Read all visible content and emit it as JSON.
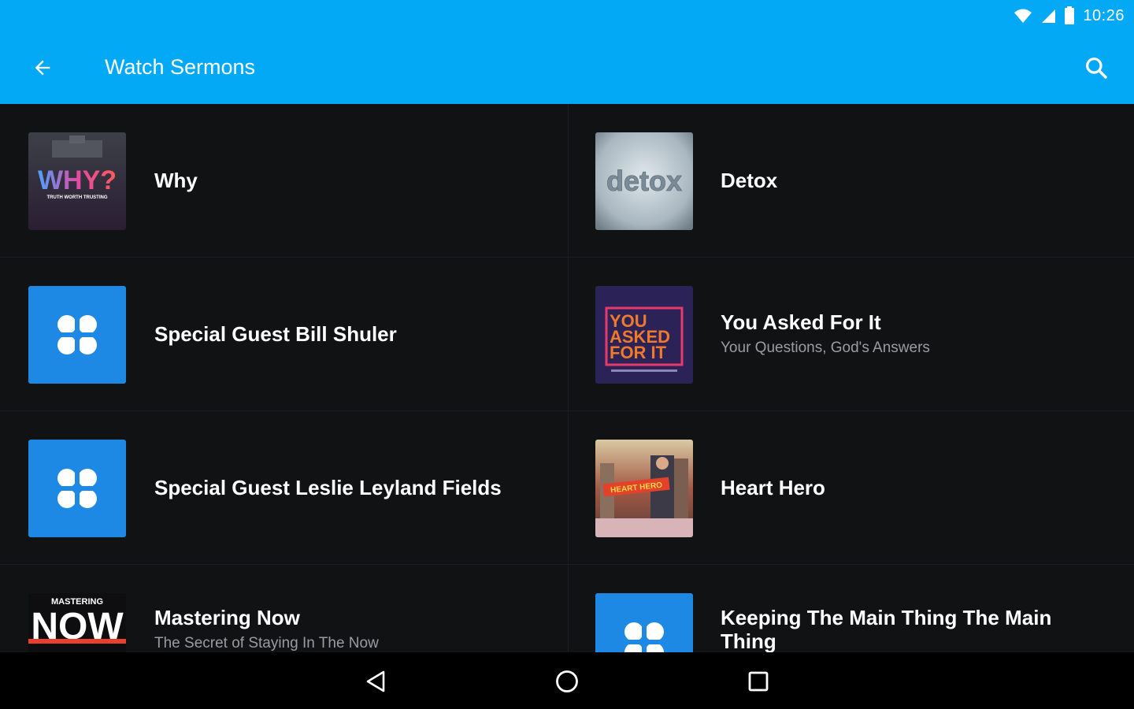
{
  "status_bar": {
    "time": "10:26",
    "icons": [
      "wifi-icon",
      "cell-signal-icon",
      "battery-icon"
    ]
  },
  "app_bar": {
    "title": "Watch Sermons",
    "back_icon": "arrow-back-icon",
    "search_icon": "search-icon",
    "color": "#03A9F4"
  },
  "sermons": [
    {
      "title": "Why",
      "subtitle": "",
      "thumb": "why-series-art"
    },
    {
      "title": "Detox",
      "subtitle": "",
      "thumb": "detox-series-art"
    },
    {
      "title": "Special Guest Bill Shuler",
      "subtitle": "",
      "thumb": "default-church-logo"
    },
    {
      "title": "You Asked For It",
      "subtitle": "Your Questions, God's Answers",
      "thumb": "you-asked-for-it-art"
    },
    {
      "title": "Special Guest Leslie Leyland Fields",
      "subtitle": "",
      "thumb": "default-church-logo"
    },
    {
      "title": "Heart Hero",
      "subtitle": "",
      "thumb": "heart-hero-art"
    },
    {
      "title": "Mastering Now",
      "subtitle": "The Secret of Staying In The Now",
      "thumb": "mastering-now-art"
    },
    {
      "title": "Keeping The Main Thing The Main Thing",
      "subtitle": "",
      "thumb": "default-church-logo"
    }
  ],
  "thumb_art": {
    "why_text": "WHY?",
    "why_tagline": "TRUTH WORTH TRUSTING",
    "detox_text": "detox",
    "yafi_lines": [
      "YOU",
      "ASKED",
      "FOR IT"
    ],
    "hero_banner": "HEART HERO",
    "now_top": "MASTERING",
    "now_big": "NOW"
  },
  "nav_bar": {
    "back": "nav-back-icon",
    "home": "nav-home-icon",
    "recents": "nav-recents-icon"
  },
  "colors": {
    "accent": "#03A9F4",
    "background": "#111214",
    "logo_tile": "#1E88E5",
    "subtitle": "#9a9ca1"
  }
}
